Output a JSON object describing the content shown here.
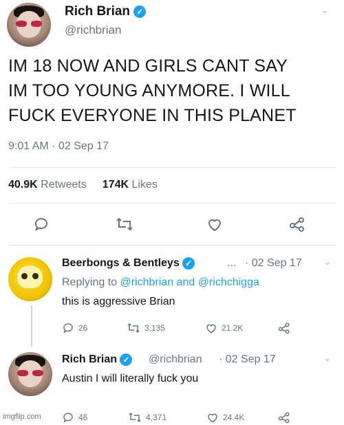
{
  "colors": {
    "accent": "#1da1f2",
    "text": "#14171a",
    "muted": "#657786",
    "divider": "#e1e8ed"
  },
  "main_tweet": {
    "name": "Rich Brian",
    "handle": "@richbrian",
    "text_lines": [
      "IM 18 NOW AND GIRLS CANT SAY",
      "IM TOO YOUNG ANYMORE. I WILL",
      "FUCK EVERYONE IN THIS PLANET"
    ],
    "timestamp": "9:01 AM · 02 Sep 17",
    "retweets_count": "40.9K",
    "retweets_label": "Retweets",
    "likes_count": "174K",
    "likes_label": "Likes",
    "icons": [
      "reply-icon",
      "retweet-icon",
      "like-icon",
      "share-icon"
    ]
  },
  "reply_1": {
    "name": "Beerbongs & Bentleys",
    "handle_truncated": "...",
    "date": "· 02 Sep 17",
    "replying_prefix": "Replying to",
    "replying_to": "@richbrian and @richchigga",
    "text": "this is aggressive Brian",
    "reply_count": "26",
    "retweet_count": "3,135",
    "like_count": "21.2K"
  },
  "reply_2": {
    "name": "Rich Brian",
    "handle": "@richbrian",
    "date": "· 02 Sep 17",
    "text": "Austin I will literally fuck you",
    "reply_count": "46",
    "retweet_count": "4,371",
    "like_count": "24.4K"
  },
  "watermark": "imgflip.com"
}
